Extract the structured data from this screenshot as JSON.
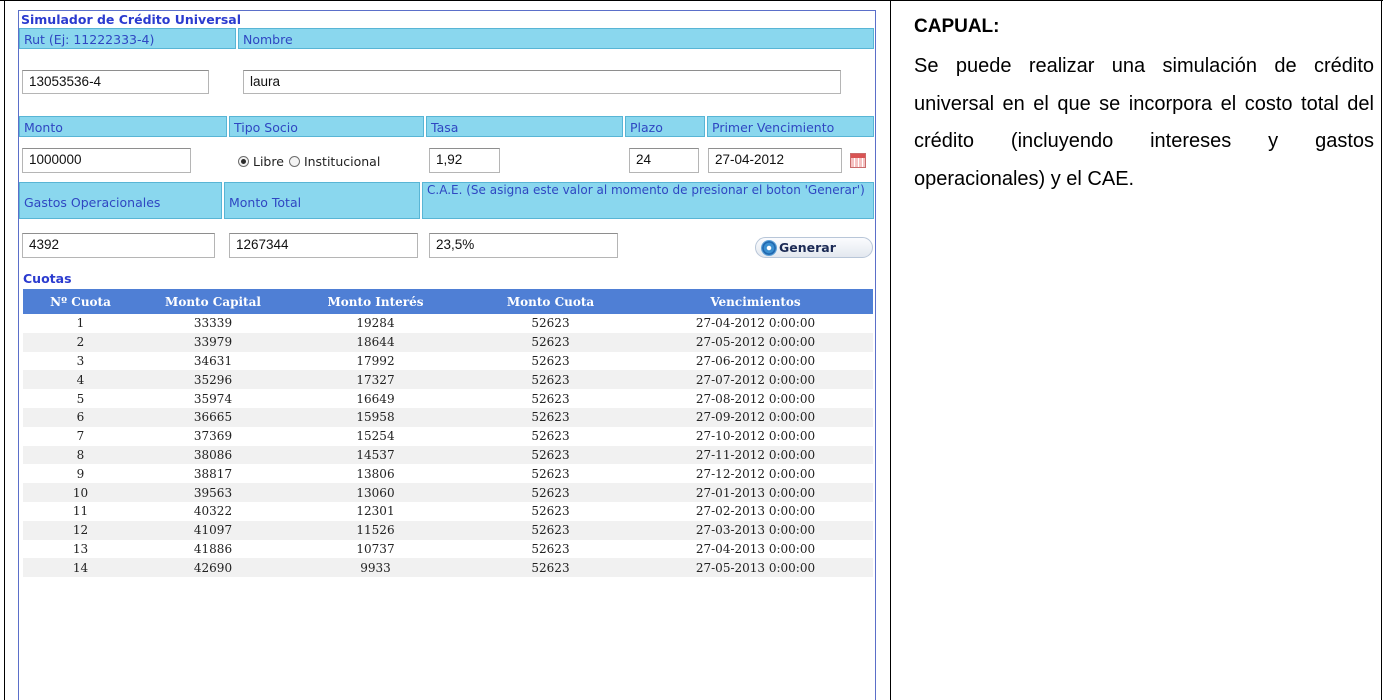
{
  "simulator": {
    "title": "Simulador de Crédito Universal",
    "rut_label": "Rut (Ej: 11222333-4)",
    "nombre_label": "Nombre",
    "rut_value": "13053536-4",
    "nombre_value": "laura",
    "monto_label": "Monto",
    "tipo_socio_label": "Tipo Socio",
    "tasa_label": "Tasa",
    "plazo_label": "Plazo",
    "primer_vencimiento_label": "Primer Vencimiento",
    "monto_value": "1000000",
    "radio_libre": "Libre",
    "radio_institucional": "Institucional",
    "selected_socio": "Libre",
    "tasa_value": "1,92",
    "plazo_value": "24",
    "primer_vencimiento_value": "27-04-2012",
    "gastos_label": "Gastos Operacionales",
    "monto_total_label": "Monto Total",
    "cae_label": "C.A.E. (Se asigna este valor al momento de presionar el boton 'Generar')",
    "gastos_value": "4392",
    "monto_total_value": "1267344",
    "cae_value": "23,5%",
    "generar_label": "Generar",
    "cuotas_title": "Cuotas"
  },
  "cuotas_table": {
    "columns": [
      "Nº Cuota",
      "Monto Capital",
      "Monto Interés",
      "Monto Cuota",
      "Vencimientos"
    ],
    "rows": [
      [
        "1",
        "33339",
        "19284",
        "52623",
        "27-04-2012 0:00:00"
      ],
      [
        "2",
        "33979",
        "18644",
        "52623",
        "27-05-2012 0:00:00"
      ],
      [
        "3",
        "34631",
        "17992",
        "52623",
        "27-06-2012 0:00:00"
      ],
      [
        "4",
        "35296",
        "17327",
        "52623",
        "27-07-2012 0:00:00"
      ],
      [
        "5",
        "35974",
        "16649",
        "52623",
        "27-08-2012 0:00:00"
      ],
      [
        "6",
        "36665",
        "15958",
        "52623",
        "27-09-2012 0:00:00"
      ],
      [
        "7",
        "37369",
        "15254",
        "52623",
        "27-10-2012 0:00:00"
      ],
      [
        "8",
        "38086",
        "14537",
        "52623",
        "27-11-2012 0:00:00"
      ],
      [
        "9",
        "38817",
        "13806",
        "52623",
        "27-12-2012 0:00:00"
      ],
      [
        "10",
        "39563",
        "13060",
        "52623",
        "27-01-2013 0:00:00"
      ],
      [
        "11",
        "40322",
        "12301",
        "52623",
        "27-02-2013 0:00:00"
      ],
      [
        "12",
        "41097",
        "11526",
        "52623",
        "27-03-2013 0:00:00"
      ],
      [
        "13",
        "41886",
        "10737",
        "52623",
        "27-04-2013 0:00:00"
      ],
      [
        "14",
        "42690",
        "9933",
        "52623",
        "27-05-2013 0:00:00"
      ]
    ]
  },
  "description": {
    "title": "CAPUAL:",
    "text": "Se puede realizar una simulación de crédito universal en el que se incorpora el costo total del crédito (incluyendo intereses y gastos operacionales) y el CAE."
  },
  "icons": {
    "calendar": "calendar-icon",
    "generar": "refresh-gear-icon"
  },
  "colors": {
    "header_bg": "#8ad7ee",
    "header_text": "#2f47c2",
    "table_header_bg": "#4f7fd5",
    "title_text": "#2b3bcf"
  }
}
